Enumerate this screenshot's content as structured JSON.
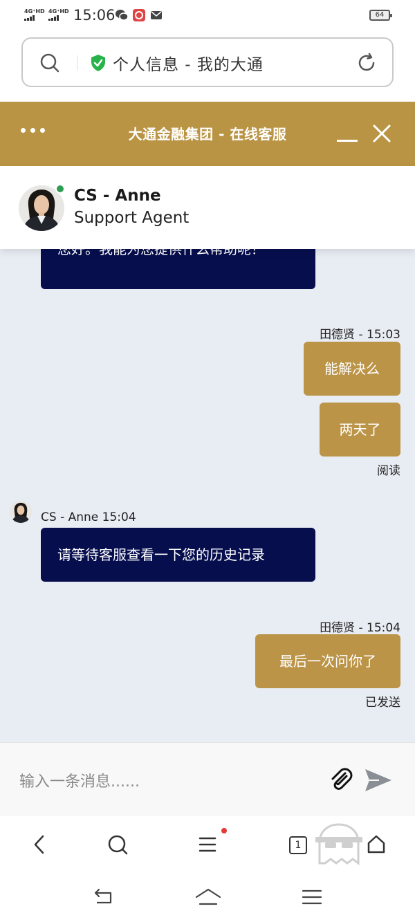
{
  "status_bar": {
    "network1": "4G⁺HD",
    "network2": "4G⁺HD",
    "time": "15:06",
    "battery": "64"
  },
  "address_bar": {
    "title": "个人信息 - 我的大通"
  },
  "chat_header": {
    "title": "大通金融集团 - 在线客服"
  },
  "agent": {
    "name": "CS - Anne",
    "role": "Support Agent",
    "status": "online",
    "status_color": "#2f9e55"
  },
  "messages": [
    {
      "from": "agent",
      "text": "您好。我能为您提供什么帮助呢？"
    },
    {
      "from": "user",
      "meta": "田德贤 - 15:03",
      "text": "能解决么"
    },
    {
      "from": "user",
      "text": "两天了",
      "status": "阅读"
    },
    {
      "from": "agent",
      "meta": "CS - Anne 15:04",
      "text": "请等待客服查看一下您的历史记录"
    },
    {
      "from": "user",
      "meta": "田德贤 - 15:04",
      "text": "最后一次问你了",
      "status": "已发送"
    }
  ],
  "input": {
    "placeholder": "输入一条消息......"
  },
  "browser_nav": {
    "tab_count": "1"
  },
  "colors": {
    "header_gold": "#b99444",
    "agent_bubble": "#060e4e",
    "user_bubble": "#bb9447",
    "chat_bg": "#e8ecf3"
  }
}
